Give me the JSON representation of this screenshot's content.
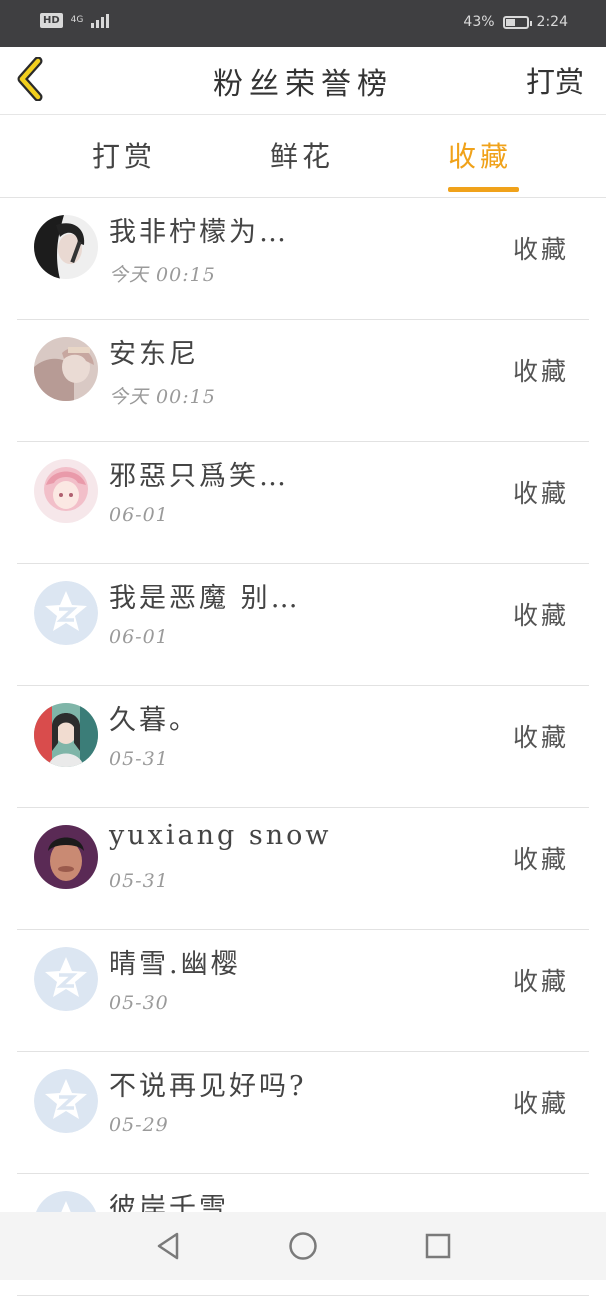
{
  "status_bar": {
    "hd": "HD",
    "network": "4G",
    "battery_text": "43%",
    "battery_level": 0.43,
    "time": "2:24"
  },
  "header": {
    "title": "粉丝荣誉榜",
    "action": "打赏"
  },
  "tabs": [
    {
      "label": "打赏"
    },
    {
      "label": "鲜花"
    },
    {
      "label": "收藏",
      "active": true
    }
  ],
  "list": [
    {
      "name": "我非柠檬为…",
      "time": "今天 00:15",
      "action": "收藏",
      "avatar": "photo-dark"
    },
    {
      "name": "安东尼",
      "time": "今天 00:15",
      "action": "收藏",
      "avatar": "photo-pink"
    },
    {
      "name": "邪惡只爲笑…",
      "time": "06-01",
      "action": "收藏",
      "avatar": "anime-pink"
    },
    {
      "name": "我是恶魔 别…",
      "time": "06-01",
      "action": "收藏",
      "avatar": "default-z"
    },
    {
      "name": "久暮。",
      "time": "05-31",
      "action": "收藏",
      "avatar": "photo-colorful"
    },
    {
      "name": "yuxiang snow",
      "time": "05-31",
      "action": "收藏",
      "avatar": "photo-face"
    },
    {
      "name": "晴雪.幽樱",
      "time": "05-30",
      "action": "收藏",
      "avatar": "default-z"
    },
    {
      "name": "不说再见好吗?",
      "time": "05-29",
      "action": "收藏",
      "avatar": "default-z"
    },
    {
      "name": "彼岸千雪",
      "time": "",
      "action": "",
      "avatar": "default-z"
    }
  ],
  "colors": {
    "accent": "#f0a21a",
    "status_bar": "#3f3f41",
    "default_avatar": "#dce6f2"
  },
  "icons": {
    "back": "chevron-left-icon",
    "nav_back": "triangle-back-icon",
    "nav_home": "circle-home-icon",
    "nav_recent": "square-recent-icon"
  }
}
